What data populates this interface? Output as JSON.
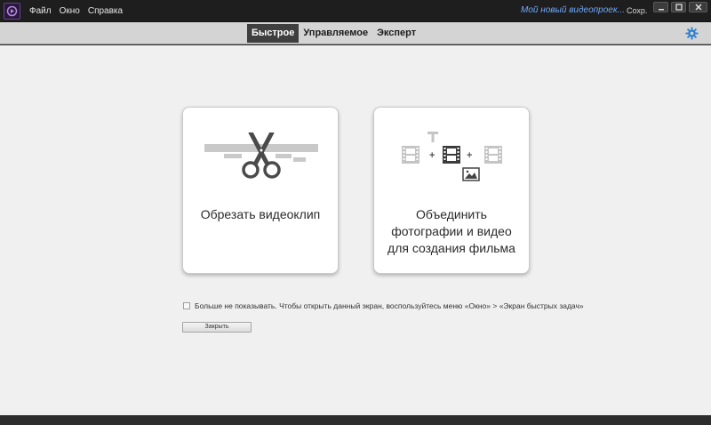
{
  "menu": {
    "items": [
      "Файл",
      "Окно",
      "Справка"
    ]
  },
  "header": {
    "project_title": "Мой новый видеопроек...",
    "save_label": "Сохр."
  },
  "modes": {
    "tabs": [
      "Быстрое",
      "Управляемое",
      "Эксперт"
    ],
    "active": "Быстрое"
  },
  "cards": [
    {
      "label": "Обрезать видеоклип",
      "icon": "scissors-trim-icon"
    },
    {
      "label_lines": [
        "Объединить",
        "фотографии и видео",
        "для создания фильма"
      ],
      "icon": "merge-media-icon"
    }
  ],
  "dont_show": {
    "checked": false,
    "text": "Больше не показывать. Чтобы открыть данный экран, воспользуйтесь меню «Окно» > «Экран быстрых задач»"
  },
  "close_button": {
    "label": "Закрыть"
  },
  "colors": {
    "title_bar": "#1e1e1e",
    "mode_bar": "#d4d4d4",
    "active_tab": "#3f3f3f",
    "accent_blue": "#6fa9ff",
    "settings_icon": "#2b7fd0",
    "main_bg": "#f0f0f0"
  }
}
